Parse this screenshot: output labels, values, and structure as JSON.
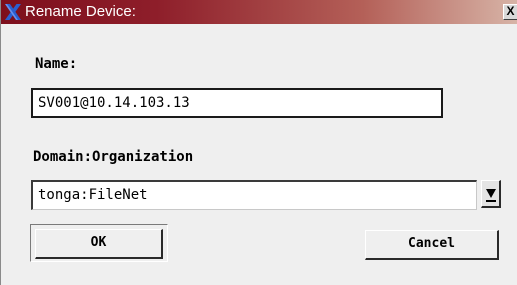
{
  "window": {
    "title": "Rename Device:",
    "close_glyph": "X",
    "icon": "x-logo-icon"
  },
  "form": {
    "name_label": "Name:",
    "name_value": "SV001@10.14.103.13",
    "domain_label": "Domain:Organization",
    "domain_value": "tonga:FileNet"
  },
  "buttons": {
    "ok_label": "OK",
    "cancel_label": "Cancel"
  },
  "colors": {
    "titlebar_start": "#7d0f1c",
    "titlebar_end": "#d7b4a7",
    "dialog_bg": "#efefef",
    "logo_blue": "#2b5fd0"
  }
}
